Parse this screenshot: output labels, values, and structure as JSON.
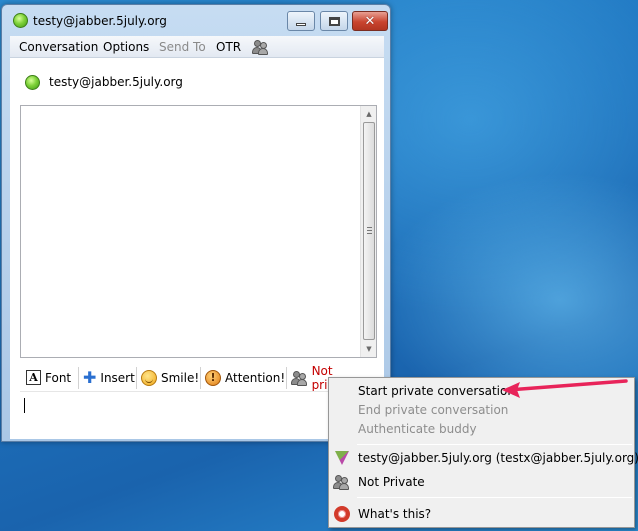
{
  "window": {
    "title": "testy@jabber.5july.org",
    "close_glyph": "✕"
  },
  "menubar": {
    "conversation": "Conversation",
    "options": "Options",
    "send_to": "Send To",
    "otr": "OTR"
  },
  "buddy": {
    "name": "testy@jabber.5july.org"
  },
  "toolbar": {
    "font": "Font",
    "insert": "Insert",
    "smile": "Smile!",
    "attention": "Attention!",
    "otr_status": "Not private"
  },
  "context_menu": {
    "start": "Start private conversation",
    "end": "End private conversation",
    "authenticate": "Authenticate buddy",
    "buddy_entry": "testy@jabber.5july.org (testx@jabber.5july.org)",
    "not_private": "Not Private",
    "whats_this": "What's this?"
  },
  "colors": {
    "otr_status_text": "#c40000",
    "arrow": "#e8245a"
  }
}
